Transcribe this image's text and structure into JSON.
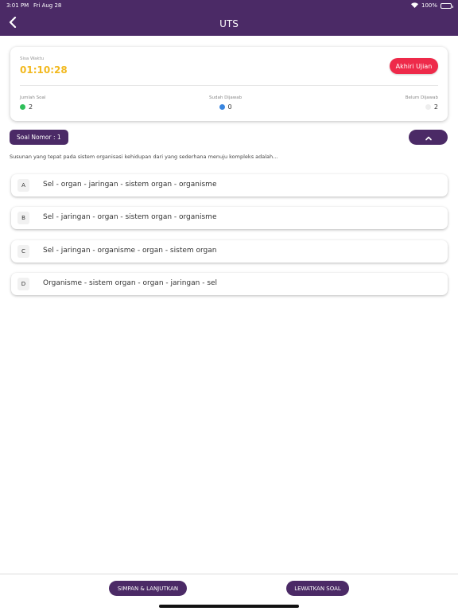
{
  "status_bar": {
    "time": "3:01 PM",
    "date": "Fri Aug 28",
    "battery": "100%"
  },
  "header": {
    "title": "UTS"
  },
  "summary": {
    "remaining_label": "Sisa Waktu",
    "timer": "01:10:28",
    "end_button": "Akhiri Ujian",
    "stats": [
      {
        "label": "Jumlah Soal",
        "value": "2",
        "color": "#2fbf5a"
      },
      {
        "label": "Sudah Dijawab",
        "value": "0",
        "color": "#3a86e0"
      },
      {
        "label": "Belum Dijawab",
        "value": "2",
        "color": "#eeeeee"
      }
    ]
  },
  "question": {
    "number_label": "Soal Nomor : 1",
    "text": "Susunan yang tepat pada sistem organisasi kehidupan dari yang sederhana menuju kompleks adalah...",
    "options": [
      {
        "letter": "A",
        "text": "Sel - organ - jaringan - sistem organ - organisme"
      },
      {
        "letter": "B",
        "text": "Sel - jaringan - organ - sistem organ - organisme"
      },
      {
        "letter": "C",
        "text": "Sel - jaringan - organisme - organ - sistem organ"
      },
      {
        "letter": "D",
        "text": "Organisme - sistem organ - organ - jaringan - sel"
      }
    ]
  },
  "footer": {
    "save_label": "SIMPAN & LANJUTKAN",
    "skip_label": "LEWATKAN SOAL"
  },
  "colors": {
    "primary": "#4b2a66",
    "danger": "#ee2a4a",
    "timer": "#f2b91f"
  },
  "icons": {
    "back": "chevron-left-icon",
    "collapse": "chevron-up-icon",
    "wifi": "wifi-icon",
    "battery": "battery-icon"
  }
}
